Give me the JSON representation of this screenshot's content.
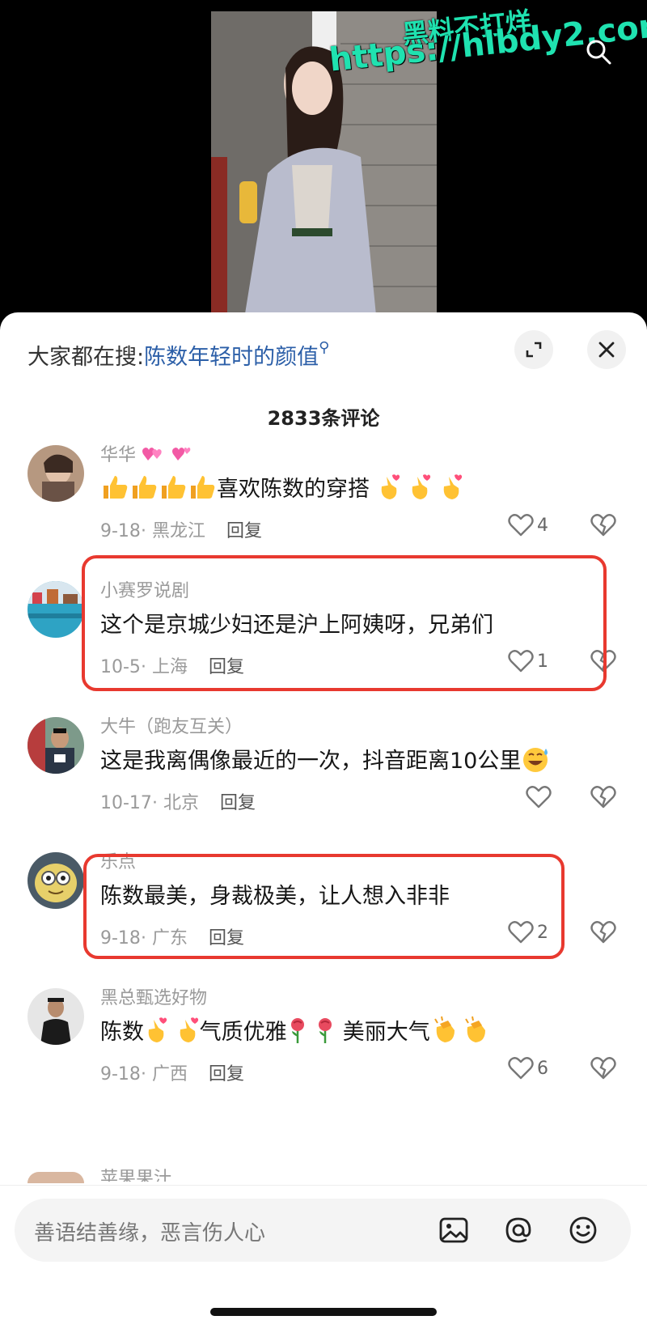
{
  "watermark": {
    "line1": "黑料不打烊",
    "line2": "https://hlbdy2.com"
  },
  "hot_search": {
    "prefix": "大家都在搜:",
    "query": "陈数年轻时的颜值"
  },
  "comment_count": {
    "number": "2833",
    "suffix": "条评论"
  },
  "comments": [
    {
      "user": "华华",
      "text": "喜欢陈数的穿搭",
      "date": "9-18",
      "location": "黑龙江",
      "reply": "回复",
      "likes": "4"
    },
    {
      "user": "小赛罗说剧",
      "text": "这个是京城少妇还是沪上阿姨呀，兄弟们",
      "date": "10-5",
      "location": "上海",
      "reply": "回复",
      "likes": "1"
    },
    {
      "user": "大牛（跑友互关）",
      "text": "这是我离偶像最近的一次，抖音距离10公里",
      "date": "10-17",
      "location": "北京",
      "reply": "回复",
      "likes": ""
    },
    {
      "user": "乐点",
      "text": "陈数最美，身裁极美，让人想入非非",
      "date": "9-18",
      "location": "广东",
      "reply": "回复",
      "likes": "2"
    },
    {
      "user": "黑总甄选好物",
      "text_a": "陈数",
      "text_b": "气质优雅",
      "text_c": "美丽大气",
      "date": "9-18",
      "location": "广西",
      "reply": "回复",
      "likes": "6"
    },
    {
      "user": "苹果果汁"
    }
  ],
  "input": {
    "placeholder": "善语结善缘，恶言伤人心"
  },
  "colors": {
    "link": "#2c5fa8",
    "highlight_box": "#e8392f",
    "watermark": "#1fe2b0"
  }
}
